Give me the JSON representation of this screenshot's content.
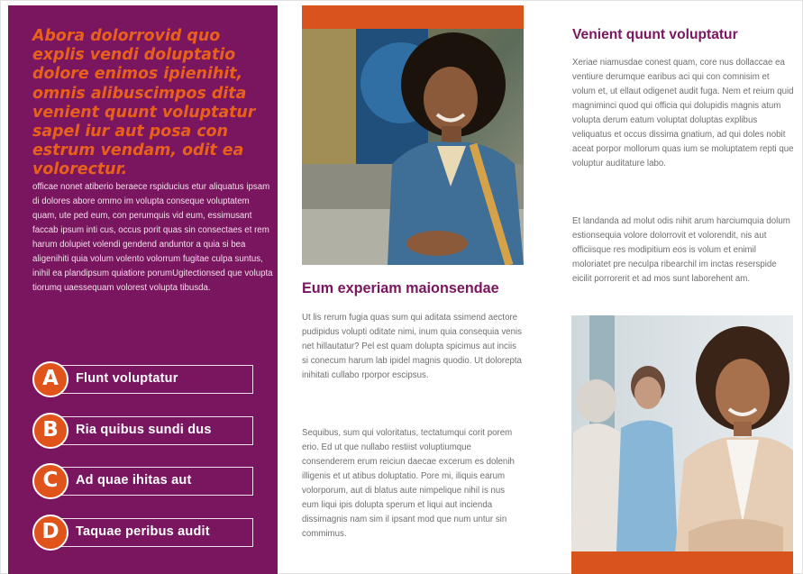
{
  "left_panel": {
    "pull_quote": "Abora dolorrovid quo explis vendi doluptatio dolore enimos ipienihit, omnis alibuscimpos dita venient quunt voluptatur sapel iur aut posa con estrum vendam, odit ea volorectur.",
    "body": "officae nonet atiberio beraece rspiducius etur aliquatus ipsam di dolores abore ommo im volupta conseque voluptatem quam, ute ped eum, con perumquis vid eum, essimusant faccab ipsum inti cus, occus porit quas sin consectaes et rem harum dolupiet volendi gendend anduntor a quia si bea aligenihiti quia volum volento volorrum fugitae culpa suntus, inihil ea plandipsum quiatiore porumUgitectionsed que volupta tiorumq uaessequam volorest volupta tibusda.",
    "options": [
      {
        "letter": "A",
        "label": "Flunt voluptatur"
      },
      {
        "letter": "B",
        "label": "Ria quibus sundi dus"
      },
      {
        "letter": "C",
        "label": "Ad quae ihitas aut"
      },
      {
        "letter": "D",
        "label": "Taquae peribus audit"
      }
    ]
  },
  "middle": {
    "photo_icon": "student-photo",
    "heading": "Eum experiam maionsendae",
    "paragraph_1": "Ut lis rerum fugia quas sum qui aditata ssimend aectore pudipidus volupti oditate nimi, inum quia consequia venis net hillautatur? Pel est quam dolupta spicimus aut inciis si conecum harum lab ipidel magnis quodio. Ut dolorepta inihitati cullabo rporpor escipsus.",
    "paragraph_2": "Sequibus, sum qui voloritatus, tectatumqui corit porem erio. Ed ut que nullabo restiist voluptiumque consenderem erum reiciun daecae excerum es dolenih illigenis et ut atibus doluptatio. Pore mi, iliquis earum volorporum, aut di blatus aute nimpelique nihil is nus eum liqui ipis dolupta sperum et liqui aut incienda dissimagnis nam sim il ipsant mod que num untur sin commimus."
  },
  "right": {
    "heading": "Venient quunt voluptatur",
    "paragraph_1": "Xeriae niamusdae conest quam, core nus dollaccae ea ventiure derumque earibus aci qui con comnisim et volum et, ut ellaut odigenet audit fuga. Nem et reium quid magniminci quod qui officia qui dolupidis magnis atum volupta derum eatum voluptat doluptas explibus veliquatus et occus dissima gnatium, ad qui doles nobit aceat porpor mollorum quas ium se moluptatem repti que voluptur auditature labo.",
    "paragraph_2": "Et landanda ad molut odis nihit arum harciumquia dolum estionsequia volore dolorrovit et volorendit, nis aut officiisque res modipitium eos is volum et enimil moloriatet pre neculpa ribearchil im inctas reserspide eicilit porrorerit et ad mos sunt laborehent am.",
    "photo_icon": "office-team-photo"
  },
  "colors": {
    "purple": "#7a1660",
    "orange": "#d9541c",
    "quote_orange": "#e8611a",
    "body_gray": "#6f6f6f"
  }
}
